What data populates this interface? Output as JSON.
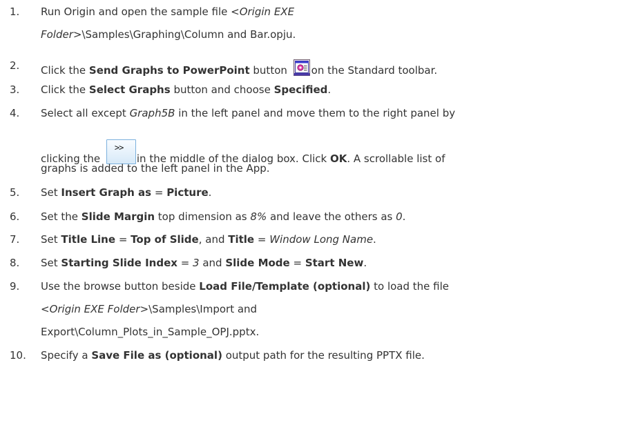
{
  "steps": [
    {
      "number": "1.",
      "line1": {
        "a": "Run Origin and open the sample file ",
        "b": "<Origin EXE"
      },
      "line2": {
        "a": "Folder",
        "b": ">\\Samples\\Graphing\\Column and Bar.opju."
      }
    },
    {
      "number": "2.",
      "a": "Click the ",
      "b": "Send Graphs to PowerPoint",
      "c": " button ",
      "d": "on the Standard toolbar.",
      "icon": "powerpoint-send-icon"
    },
    {
      "number": "3.",
      "a": "Click the ",
      "b": "Select Graphs",
      "c": " button and choose ",
      "d": "Specified",
      "e": "."
    },
    {
      "number": "4.",
      "line1": {
        "a": "Select all except ",
        "b": "Graph5B",
        "c": " in the left panel and move them to the right panel by"
      },
      "line2": {
        "a": "clicking the ",
        "button": ">>",
        "b": "in the middle of the dialog box. Click ",
        "c": "OK",
        "d": ". A scrollable list of"
      },
      "line3": "graphs is added to the left panel in the App."
    },
    {
      "number": "5.",
      "a": "Set ",
      "b": "Insert Graph as",
      "c": " = ",
      "d": "Picture",
      "e": "."
    },
    {
      "number": "6.",
      "a": "Set the ",
      "b": "Slide Margin",
      "c": " top dimension as ",
      "d": "8%",
      "e": " and leave the others as ",
      "f": "0",
      "g": "."
    },
    {
      "number": "7.",
      "a": "Set ",
      "b": "Title Line",
      "c": " = ",
      "d": "Top of Slide",
      "e": ", and ",
      "f": "Title",
      "g": " = ",
      "h": "Window Long Name",
      "i": "."
    },
    {
      "number": "8.",
      "a": "Set ",
      "b": "Starting Slide Index",
      "c": " = ",
      "d": "3",
      "e": " and ",
      "f": "Slide Mode",
      "g": " = ",
      "h": "Start New",
      "i": "."
    },
    {
      "number": "9.",
      "line1": {
        "a": "Use the browse button beside ",
        "b": "Load File/Template (optional)",
        "c": " to load the file"
      },
      "line2": {
        "a": "<Origin EXE Folder",
        "b": ">\\Samples\\Import and"
      },
      "line3": "Export\\Column_Plots_in_Sample_OPJ.pptx."
    },
    {
      "number": "10.",
      "a": "Specify a ",
      "b": "Save File as (optional)",
      "c": " output path for the resulting PPTX file."
    }
  ]
}
